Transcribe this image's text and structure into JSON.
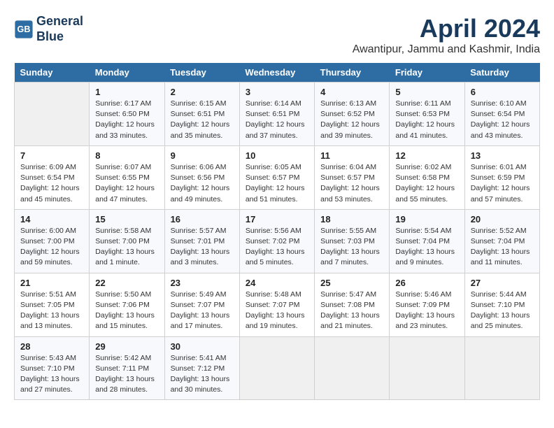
{
  "header": {
    "logo_line1": "General",
    "logo_line2": "Blue",
    "month_year": "April 2024",
    "location": "Awantipur, Jammu and Kashmir, India"
  },
  "days_of_week": [
    "Sunday",
    "Monday",
    "Tuesday",
    "Wednesday",
    "Thursday",
    "Friday",
    "Saturday"
  ],
  "weeks": [
    [
      {
        "num": "",
        "empty": true
      },
      {
        "num": "1",
        "sunrise": "Sunrise: 6:17 AM",
        "sunset": "Sunset: 6:50 PM",
        "daylight": "Daylight: 12 hours and 33 minutes."
      },
      {
        "num": "2",
        "sunrise": "Sunrise: 6:15 AM",
        "sunset": "Sunset: 6:51 PM",
        "daylight": "Daylight: 12 hours and 35 minutes."
      },
      {
        "num": "3",
        "sunrise": "Sunrise: 6:14 AM",
        "sunset": "Sunset: 6:51 PM",
        "daylight": "Daylight: 12 hours and 37 minutes."
      },
      {
        "num": "4",
        "sunrise": "Sunrise: 6:13 AM",
        "sunset": "Sunset: 6:52 PM",
        "daylight": "Daylight: 12 hours and 39 minutes."
      },
      {
        "num": "5",
        "sunrise": "Sunrise: 6:11 AM",
        "sunset": "Sunset: 6:53 PM",
        "daylight": "Daylight: 12 hours and 41 minutes."
      },
      {
        "num": "6",
        "sunrise": "Sunrise: 6:10 AM",
        "sunset": "Sunset: 6:54 PM",
        "daylight": "Daylight: 12 hours and 43 minutes."
      }
    ],
    [
      {
        "num": "7",
        "sunrise": "Sunrise: 6:09 AM",
        "sunset": "Sunset: 6:54 PM",
        "daylight": "Daylight: 12 hours and 45 minutes."
      },
      {
        "num": "8",
        "sunrise": "Sunrise: 6:07 AM",
        "sunset": "Sunset: 6:55 PM",
        "daylight": "Daylight: 12 hours and 47 minutes."
      },
      {
        "num": "9",
        "sunrise": "Sunrise: 6:06 AM",
        "sunset": "Sunset: 6:56 PM",
        "daylight": "Daylight: 12 hours and 49 minutes."
      },
      {
        "num": "10",
        "sunrise": "Sunrise: 6:05 AM",
        "sunset": "Sunset: 6:57 PM",
        "daylight": "Daylight: 12 hours and 51 minutes."
      },
      {
        "num": "11",
        "sunrise": "Sunrise: 6:04 AM",
        "sunset": "Sunset: 6:57 PM",
        "daylight": "Daylight: 12 hours and 53 minutes."
      },
      {
        "num": "12",
        "sunrise": "Sunrise: 6:02 AM",
        "sunset": "Sunset: 6:58 PM",
        "daylight": "Daylight: 12 hours and 55 minutes."
      },
      {
        "num": "13",
        "sunrise": "Sunrise: 6:01 AM",
        "sunset": "Sunset: 6:59 PM",
        "daylight": "Daylight: 12 hours and 57 minutes."
      }
    ],
    [
      {
        "num": "14",
        "sunrise": "Sunrise: 6:00 AM",
        "sunset": "Sunset: 7:00 PM",
        "daylight": "Daylight: 12 hours and 59 minutes."
      },
      {
        "num": "15",
        "sunrise": "Sunrise: 5:58 AM",
        "sunset": "Sunset: 7:00 PM",
        "daylight": "Daylight: 13 hours and 1 minute."
      },
      {
        "num": "16",
        "sunrise": "Sunrise: 5:57 AM",
        "sunset": "Sunset: 7:01 PM",
        "daylight": "Daylight: 13 hours and 3 minutes."
      },
      {
        "num": "17",
        "sunrise": "Sunrise: 5:56 AM",
        "sunset": "Sunset: 7:02 PM",
        "daylight": "Daylight: 13 hours and 5 minutes."
      },
      {
        "num": "18",
        "sunrise": "Sunrise: 5:55 AM",
        "sunset": "Sunset: 7:03 PM",
        "daylight": "Daylight: 13 hours and 7 minutes."
      },
      {
        "num": "19",
        "sunrise": "Sunrise: 5:54 AM",
        "sunset": "Sunset: 7:04 PM",
        "daylight": "Daylight: 13 hours and 9 minutes."
      },
      {
        "num": "20",
        "sunrise": "Sunrise: 5:52 AM",
        "sunset": "Sunset: 7:04 PM",
        "daylight": "Daylight: 13 hours and 11 minutes."
      }
    ],
    [
      {
        "num": "21",
        "sunrise": "Sunrise: 5:51 AM",
        "sunset": "Sunset: 7:05 PM",
        "daylight": "Daylight: 13 hours and 13 minutes."
      },
      {
        "num": "22",
        "sunrise": "Sunrise: 5:50 AM",
        "sunset": "Sunset: 7:06 PM",
        "daylight": "Daylight: 13 hours and 15 minutes."
      },
      {
        "num": "23",
        "sunrise": "Sunrise: 5:49 AM",
        "sunset": "Sunset: 7:07 PM",
        "daylight": "Daylight: 13 hours and 17 minutes."
      },
      {
        "num": "24",
        "sunrise": "Sunrise: 5:48 AM",
        "sunset": "Sunset: 7:07 PM",
        "daylight": "Daylight: 13 hours and 19 minutes."
      },
      {
        "num": "25",
        "sunrise": "Sunrise: 5:47 AM",
        "sunset": "Sunset: 7:08 PM",
        "daylight": "Daylight: 13 hours and 21 minutes."
      },
      {
        "num": "26",
        "sunrise": "Sunrise: 5:46 AM",
        "sunset": "Sunset: 7:09 PM",
        "daylight": "Daylight: 13 hours and 23 minutes."
      },
      {
        "num": "27",
        "sunrise": "Sunrise: 5:44 AM",
        "sunset": "Sunset: 7:10 PM",
        "daylight": "Daylight: 13 hours and 25 minutes."
      }
    ],
    [
      {
        "num": "28",
        "sunrise": "Sunrise: 5:43 AM",
        "sunset": "Sunset: 7:10 PM",
        "daylight": "Daylight: 13 hours and 27 minutes."
      },
      {
        "num": "29",
        "sunrise": "Sunrise: 5:42 AM",
        "sunset": "Sunset: 7:11 PM",
        "daylight": "Daylight: 13 hours and 28 minutes."
      },
      {
        "num": "30",
        "sunrise": "Sunrise: 5:41 AM",
        "sunset": "Sunset: 7:12 PM",
        "daylight": "Daylight: 13 hours and 30 minutes."
      },
      {
        "num": "",
        "empty": true
      },
      {
        "num": "",
        "empty": true
      },
      {
        "num": "",
        "empty": true
      },
      {
        "num": "",
        "empty": true
      }
    ]
  ]
}
